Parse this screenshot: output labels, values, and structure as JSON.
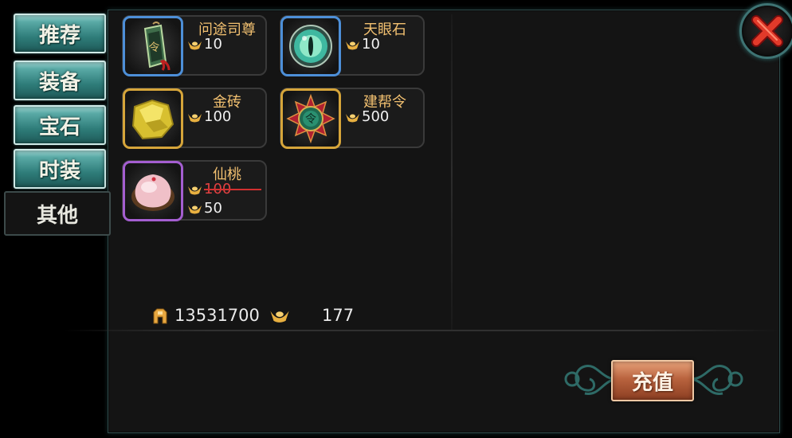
{
  "tabs": [
    {
      "label": "推荐",
      "active": false
    },
    {
      "label": "装备",
      "active": false
    },
    {
      "label": "宝石",
      "active": false
    },
    {
      "label": "时装",
      "active": false
    },
    {
      "label": "其他",
      "active": true
    }
  ],
  "items": [
    {
      "name": "问途司尊",
      "price": "10",
      "icon": "token-plaque-icon",
      "frame_color": "#4d8fd8"
    },
    {
      "name": "天眼石",
      "price": "10",
      "icon": "eye-stone-icon",
      "frame_color": "#4d8fd8"
    },
    {
      "name": "金砖",
      "price": "100",
      "icon": "gold-brick-icon",
      "frame_color": "#d6a53a"
    },
    {
      "name": "建帮令",
      "price": "500",
      "icon": "guild-emblem-icon",
      "frame_color": "#d6a53a"
    },
    {
      "name": "仙桃",
      "original_price": "100",
      "price": "50",
      "icon": "peach-icon",
      "frame_color": "#a45ed0"
    }
  ],
  "currency": {
    "copper": "13531700",
    "ingot": "177"
  },
  "recharge_label": "充值",
  "colors": {
    "tab_teal": "#2f7d7a",
    "item_name": "#f2c070",
    "discount_red": "#d23030",
    "recharge": "#b9633e"
  }
}
